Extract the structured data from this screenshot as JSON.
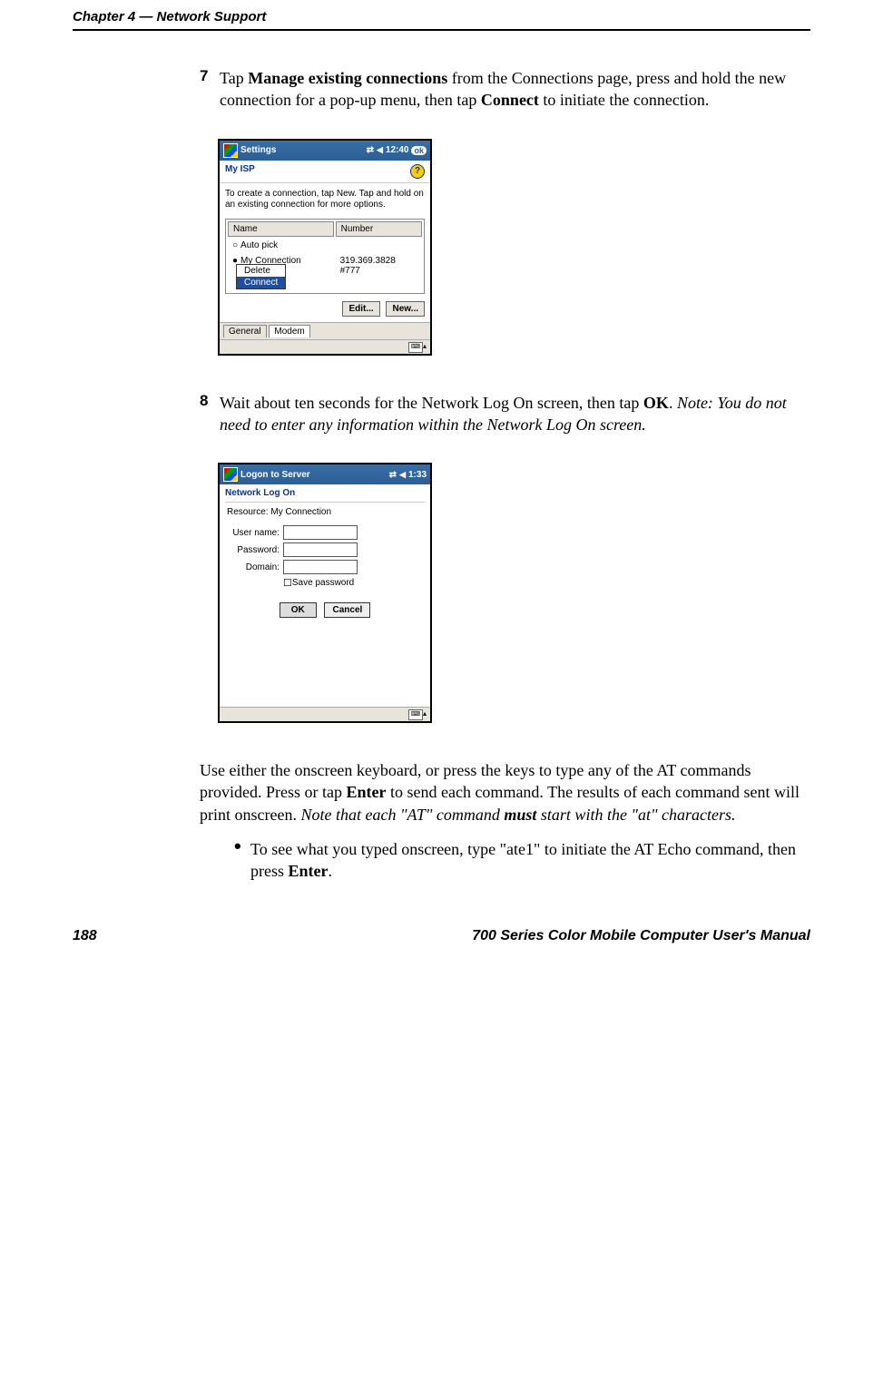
{
  "header": {
    "chapter": "Chapter 4",
    "dash": "  —  ",
    "title": "Network Support"
  },
  "step7": {
    "number": "7",
    "part1": "Tap ",
    "bold1": "Manage existing connections",
    "part2": " from the Connections page, press and hold the new connection for a pop-up menu, then tap ",
    "bold2": "Connect",
    "part3": " to initiate the connection."
  },
  "ss1": {
    "title": "Settings",
    "time": "12:40",
    "ok": "ok",
    "heading": "My ISP",
    "hint": "To create a connection, tap New. Tap and hold on an existing connection for more options.",
    "col1": "Name",
    "col2": "Number",
    "row1": "Auto pick",
    "row2": "My Connection",
    "phone1": "319.369.3828",
    "phone2": "#777",
    "menu_delete": "Delete",
    "menu_connect": "Connect",
    "edit": "Edit...",
    "newbtn": "New...",
    "tab1": "General",
    "tab2": "Modem"
  },
  "step8": {
    "number": "8",
    "part1": "Wait about ten seconds for the Network Log On screen, then tap ",
    "bold1": "OK",
    "part2": ". ",
    "note": "Note: You do not need to enter any information within the Network Log On screen."
  },
  "ss2": {
    "title": "Logon to Server",
    "time": "1:33",
    "heading": "Network Log On",
    "resource_label": "Resource:  ",
    "resource_value": "My Connection",
    "username": "User name:",
    "password": "Password:",
    "domain": "Domain:",
    "savepw": "Save password",
    "ok": "OK",
    "cancel": "Cancel"
  },
  "para": {
    "p1": "Use either the onscreen keyboard, or press the keys to type any of the AT commands provided. Press or tap ",
    "b1": "Enter",
    "p2": " to send each command. The results of each command sent will print onscreen. ",
    "i1": "Note that each \"AT\" command ",
    "ib1": "must",
    "i2": " start with the \"at\" characters."
  },
  "bullet": {
    "t1": "To see what you typed onscreen, type \"ate1\" to initiate the AT Echo command, then press ",
    "b1": "Enter",
    "t2": "."
  },
  "footer": {
    "page": "188",
    "doc": "700 Series Color Mobile Computer User's Manual"
  }
}
